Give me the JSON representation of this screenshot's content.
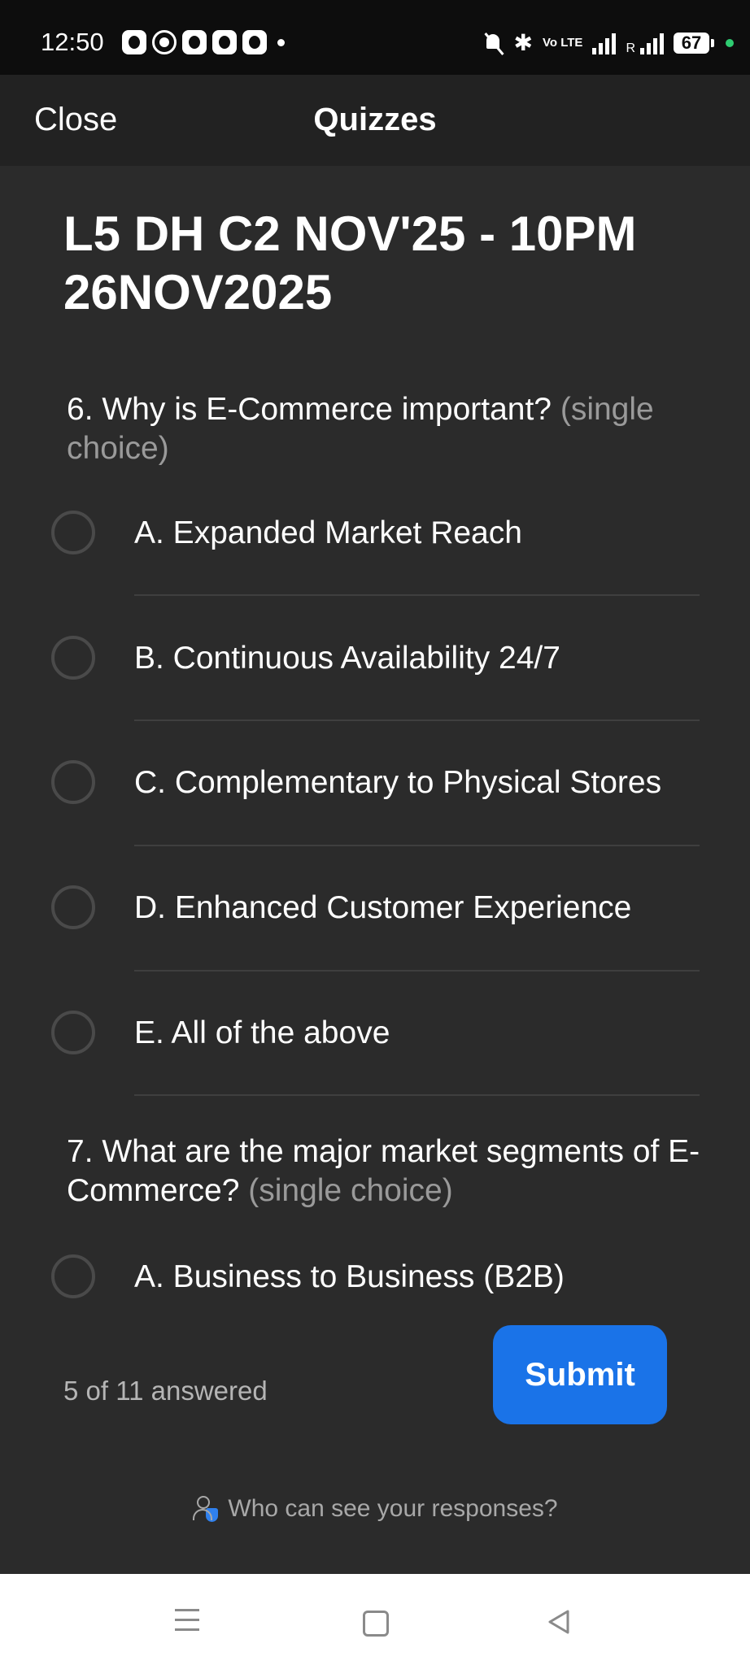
{
  "status_bar": {
    "time": "12:50",
    "battery": "67",
    "network_r": "R",
    "volte": "Vo LTE"
  },
  "header": {
    "close_label": "Close",
    "title": "Quizzes"
  },
  "quiz": {
    "title": "L5 DH C2 NOV'25 - 10PM 26NOV2025",
    "questions": [
      {
        "text": "6. Why is E-Commerce important?",
        "hint": "(single choice)",
        "options": [
          {
            "label": "A. Expanded Market Reach"
          },
          {
            "label": "B. Continuous Availability 24/7"
          },
          {
            "label": "C. Complementary to Physical Stores"
          },
          {
            "label": "D. Enhanced Customer Experience"
          },
          {
            "label": "E. All of the above"
          }
        ]
      },
      {
        "text": "7. What are the major market segments of E-Commerce?",
        "hint": "(single choice)",
        "options": [
          {
            "label": "A. Business to Business (B2B)"
          }
        ]
      }
    ]
  },
  "footer": {
    "answered_text": "5 of 11 answered",
    "submit_label": "Submit",
    "privacy_text": "Who can see your responses?"
  },
  "icons": {
    "status": [
      "notification-icon",
      "whatsapp-icon",
      "notification-icon",
      "notification-icon",
      "notification-icon"
    ],
    "system": [
      "mute-icon",
      "bluetooth-icon",
      "volte-icon",
      "signal-icon",
      "signal-icon",
      "battery-icon"
    ],
    "nav": [
      "menu-icon",
      "home-icon",
      "back-icon"
    ]
  },
  "colors": {
    "accent": "#1a73e8",
    "background": "#2b2b2b",
    "header": "#222222"
  }
}
